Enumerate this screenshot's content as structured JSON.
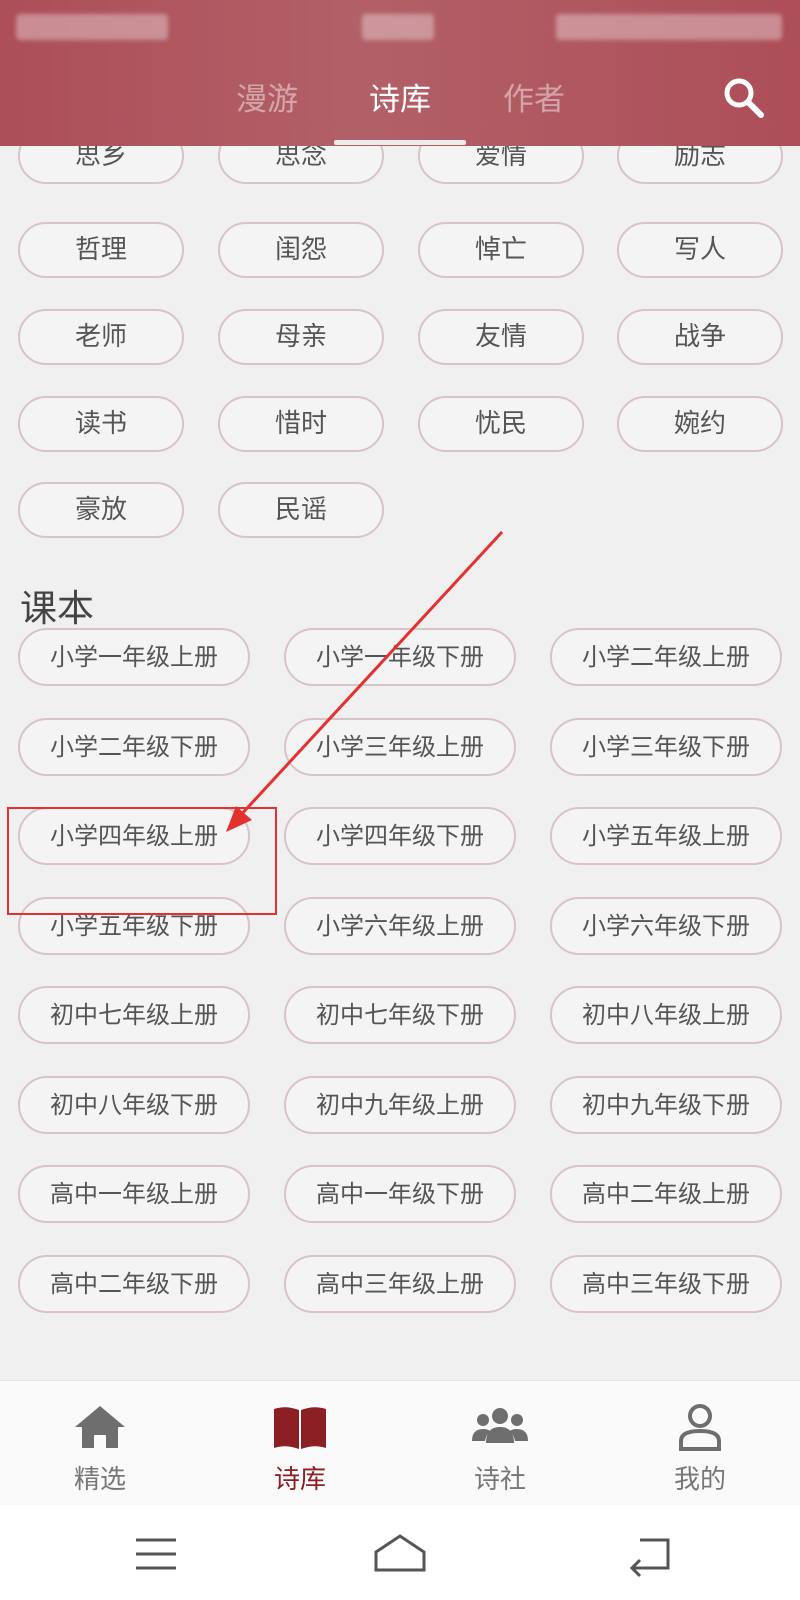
{
  "header": {
    "tabs": [
      {
        "label": "漫游",
        "active": false
      },
      {
        "label": "诗库",
        "active": true
      },
      {
        "label": "作者",
        "active": false
      }
    ],
    "search_icon": "search-icon"
  },
  "tags_partial": [
    "思乡",
    "思念",
    "爱情",
    "励志"
  ],
  "tags": [
    "哲理",
    "闺怨",
    "悼亡",
    "写人",
    "老师",
    "母亲",
    "友情",
    "战争",
    "读书",
    "惜时",
    "忧民",
    "婉约",
    "豪放",
    "民谣"
  ],
  "textbook": {
    "title": "课本",
    "items": [
      "小学一年级上册",
      "小学一年级下册",
      "小学二年级上册",
      "小学二年级下册",
      "小学三年级上册",
      "小学三年级下册",
      "小学四年级上册",
      "小学四年级下册",
      "小学五年级上册",
      "小学五年级下册",
      "小学六年级上册",
      "小学六年级下册",
      "初中七年级上册",
      "初中七年级下册",
      "初中八年级上册",
      "初中八年级下册",
      "初中九年级上册",
      "初中九年级下册",
      "高中一年级上册",
      "高中一年级下册",
      "高中二年级上册",
      "高中二年级下册",
      "高中三年级上册",
      "高中三年级下册"
    ],
    "highlighted_item": "小学四年级上册"
  },
  "bottom_nav": [
    {
      "label": "精选",
      "icon": "home-icon",
      "active": false
    },
    {
      "label": "诗库",
      "icon": "book-icon",
      "active": true
    },
    {
      "label": "诗社",
      "icon": "group-icon",
      "active": false
    },
    {
      "label": "我的",
      "icon": "user-icon",
      "active": false
    }
  ],
  "colors": {
    "header_bg": "#ad4e58",
    "accent": "#8b1f24",
    "chip_border": "#d8c3c6",
    "annotation": "#e53030"
  }
}
